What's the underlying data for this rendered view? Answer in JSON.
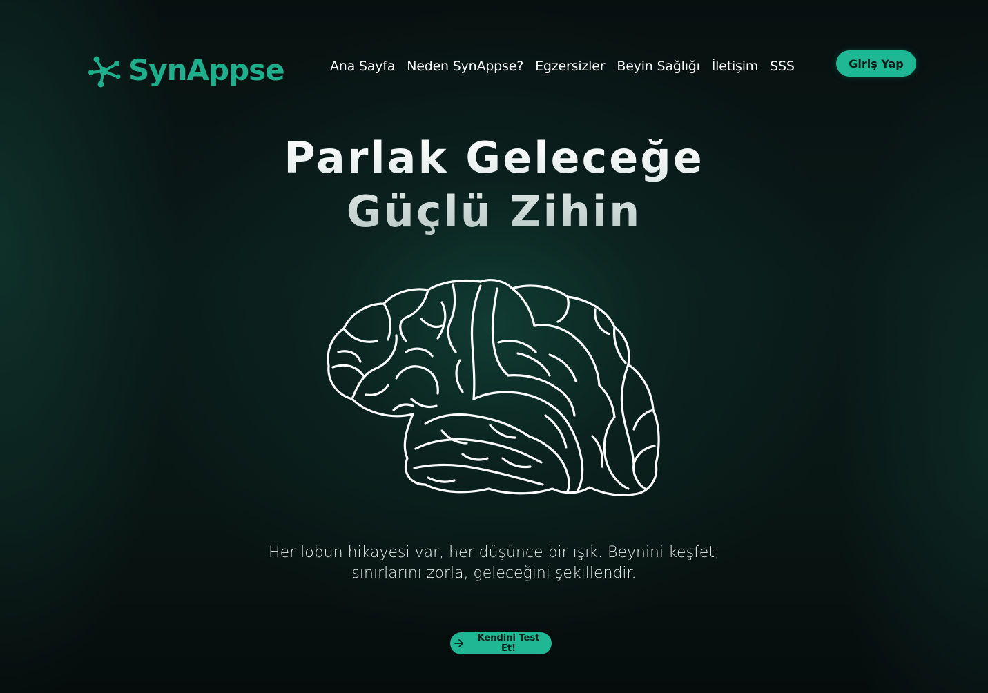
{
  "header": {
    "logo_text": "SynAppse",
    "logo_icon": "molecule-network-icon",
    "brand_color": "#1fae8c",
    "nav": [
      {
        "label": "Ana Sayfa"
      },
      {
        "label": "Neden SynAppse?"
      },
      {
        "label": "Egzersizler"
      },
      {
        "label": "Beyin Sağlığı"
      },
      {
        "label": "İletişim"
      },
      {
        "label": "SSS"
      }
    ],
    "login_label": "Giriş Yap"
  },
  "hero": {
    "title_line1": "Parlak Geleceğe",
    "title_line2": "Güçlü Zihin",
    "illustration_icon": "brain-outline-icon",
    "tagline_line1": "Her lobun hikayesi var, her düşünce bir ışık. Beynini keşfet,",
    "tagline_line2": "sınırlarını zorla, geleceğini şekillendir.",
    "cta_label": "Kendini Test Et!",
    "cta_icon": "arrow-right-icon",
    "accent_color": "#1fb794"
  }
}
